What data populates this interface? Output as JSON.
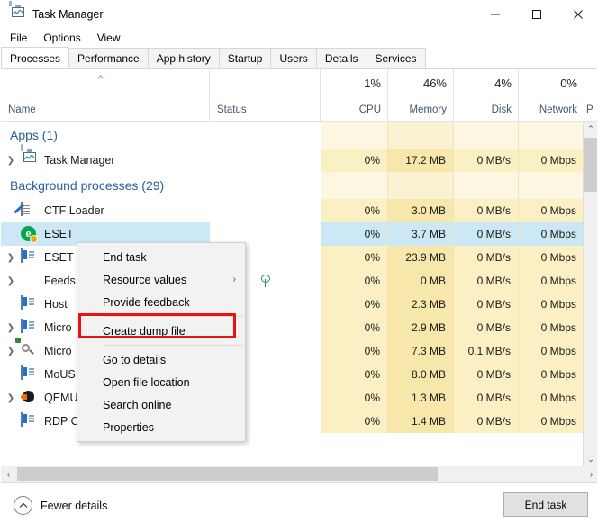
{
  "window": {
    "title": "Task Manager",
    "icon": "task-manager-icon",
    "controls": {
      "minimize": "–",
      "maximize": "☐",
      "close": "✕"
    }
  },
  "menubar": {
    "items": [
      "File",
      "Options",
      "View"
    ]
  },
  "tabs": [
    {
      "label": "Processes",
      "active": true
    },
    {
      "label": "Performance",
      "active": false
    },
    {
      "label": "App history",
      "active": false
    },
    {
      "label": "Startup",
      "active": false
    },
    {
      "label": "Users",
      "active": false
    },
    {
      "label": "Details",
      "active": false
    },
    {
      "label": "Services",
      "active": false
    }
  ],
  "columns": [
    {
      "key": "name",
      "label": "Name",
      "value": "",
      "align": "left",
      "sorted": true
    },
    {
      "key": "status",
      "label": "Status",
      "value": "",
      "align": "left",
      "sorted": false
    },
    {
      "key": "cpu",
      "label": "CPU",
      "value": "1%",
      "align": "right",
      "sorted": false
    },
    {
      "key": "memory",
      "label": "Memory",
      "value": "46%",
      "align": "right",
      "sorted": false
    },
    {
      "key": "disk",
      "label": "Disk",
      "value": "4%",
      "align": "right",
      "sorted": false
    },
    {
      "key": "network",
      "label": "Network",
      "value": "0%",
      "align": "right",
      "sorted": false
    },
    {
      "key": "p",
      "label": "P",
      "value": "",
      "align": "right",
      "sorted": false
    }
  ],
  "rows": [
    {
      "type": "group",
      "label": "Apps (1)"
    },
    {
      "type": "process",
      "name": "Task Manager",
      "icon": "task-manager-icon",
      "expander": true,
      "status": "",
      "cpu": "0%",
      "memory": "17.2 MB",
      "disk": "0 MB/s",
      "network": "0 Mbps",
      "selected": false
    },
    {
      "type": "group",
      "label": "Background processes (29)"
    },
    {
      "type": "process",
      "name": "CTF Loader",
      "icon": "ctf-loader-icon",
      "expander": false,
      "status": "",
      "cpu": "0%",
      "memory": "3.0 MB",
      "disk": "0 MB/s",
      "network": "0 Mbps",
      "selected": false
    },
    {
      "type": "process",
      "name": "ESET",
      "icon": "eset-icon",
      "expander": false,
      "status": "",
      "cpu": "0%",
      "memory": "3.7 MB",
      "disk": "0 MB/s",
      "network": "0 Mbps",
      "selected": true
    },
    {
      "type": "process",
      "name": "ESET",
      "icon": "generic-app-icon",
      "expander": true,
      "status": "",
      "cpu": "0%",
      "memory": "23.9 MB",
      "disk": "0 MB/s",
      "network": "0 Mbps",
      "selected": false
    },
    {
      "type": "process",
      "name": "Feeds",
      "icon": "feeds-icon",
      "expander": true,
      "status": "leaf-icon",
      "cpu": "0%",
      "memory": "0 MB",
      "disk": "0 MB/s",
      "network": "0 Mbps",
      "selected": false
    },
    {
      "type": "process",
      "name": "Host",
      "icon": "generic-app-icon",
      "expander": false,
      "status": "",
      "cpu": "0%",
      "memory": "2.3 MB",
      "disk": "0 MB/s",
      "network": "0 Mbps",
      "selected": false
    },
    {
      "type": "process",
      "name": "Micro",
      "icon": "generic-app-icon",
      "expander": true,
      "status": "",
      "cpu": "0%",
      "memory": "2.9 MB",
      "disk": "0 MB/s",
      "network": "0 Mbps",
      "selected": false
    },
    {
      "type": "process",
      "name": "Micro",
      "icon": "magnifier-icon",
      "expander": true,
      "status": "",
      "cpu": "0%",
      "memory": "7.3 MB",
      "disk": "0.1 MB/s",
      "network": "0 Mbps",
      "selected": false
    },
    {
      "type": "process",
      "name": "MoUS",
      "icon": "generic-app-icon",
      "expander": false,
      "status": "",
      "cpu": "0%",
      "memory": "8.0 MB",
      "disk": "0 MB/s",
      "network": "0 Mbps",
      "selected": false
    },
    {
      "type": "process",
      "name": "QEMU machine emulators and t...",
      "icon": "qemu-icon",
      "expander": true,
      "status": "",
      "cpu": "0%",
      "memory": "1.3 MB",
      "disk": "0 MB/s",
      "network": "0 Mbps",
      "selected": false
    },
    {
      "type": "process",
      "name": "RDP Clipboard Monitor",
      "icon": "generic-app-icon",
      "expander": false,
      "status": "",
      "cpu": "0%",
      "memory": "1.4 MB",
      "disk": "0 MB/s",
      "network": "0 Mbps",
      "selected": false
    }
  ],
  "context_menu": {
    "items": [
      {
        "label": "End task",
        "submenu": false,
        "highlighted": false
      },
      {
        "label": "Resource values",
        "submenu": true,
        "highlighted": false
      },
      {
        "label": "Provide feedback",
        "submenu": false,
        "highlighted": false
      },
      {
        "label": "Create dump file",
        "submenu": false,
        "highlighted": true
      },
      {
        "label": "Go to details",
        "submenu": false,
        "highlighted": false
      },
      {
        "label": "Open file location",
        "submenu": false,
        "highlighted": false
      },
      {
        "label": "Search online",
        "submenu": false,
        "highlighted": false
      },
      {
        "label": "Properties",
        "submenu": false,
        "highlighted": false
      }
    ],
    "submenu_arrow": "›",
    "highlight_color": "#ee1111"
  },
  "statusbar": {
    "fewer_details": "Fewer details",
    "fewer_details_icon": "chevron-up-circle-icon",
    "end_task": "End task"
  },
  "scrollbars": {
    "vertical": {
      "up": "⌃",
      "down": "⌄"
    },
    "horizontal": {
      "left": "‹",
      "right": "›"
    }
  },
  "colors": {
    "heat_light": "#fdf6e0",
    "heat_mid": "#fbefc4",
    "heat_strong": "#f8e7ab",
    "selection": "#cce8f4",
    "group_text": "#2a6099",
    "header_text": "#44546a"
  }
}
